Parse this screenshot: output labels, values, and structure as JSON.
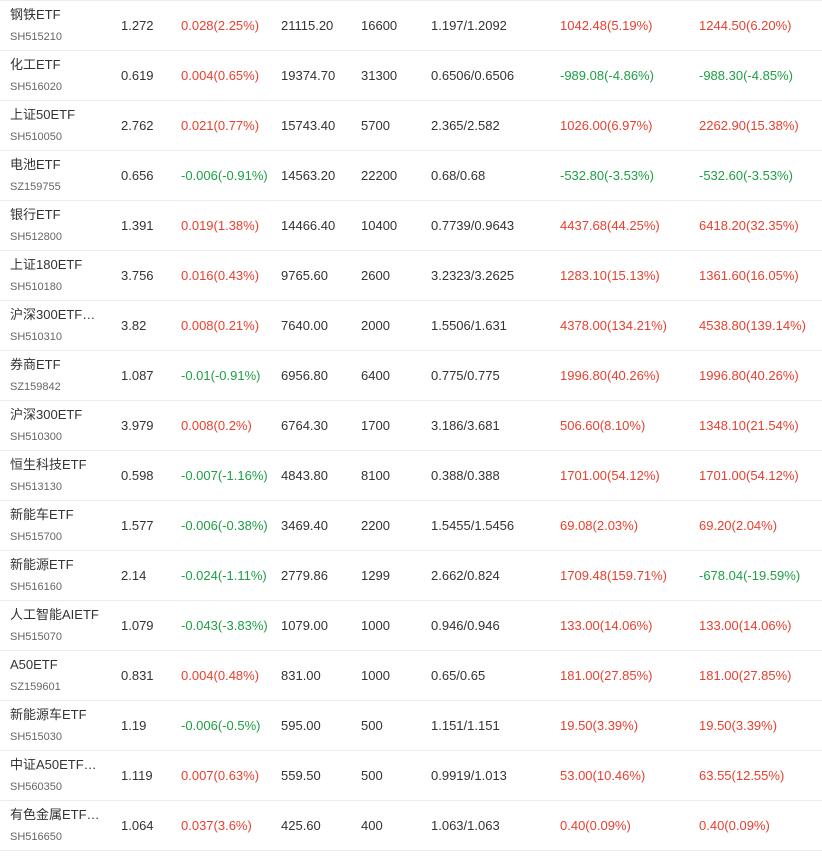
{
  "colors": {
    "up": "#e8402f",
    "down": "#1e9e45"
  },
  "rows": [
    {
      "name": "钢铁ETF",
      "code": "SH515210",
      "price": "1.272",
      "change": "0.028(2.25%)",
      "change_dir": "up",
      "amount": "21115.20",
      "shares": "16600",
      "cost": "1.197/1.2092",
      "pl1": "1042.48(5.19%)",
      "pl1_dir": "up",
      "pl2": "1244.50(6.20%)",
      "pl2_dir": "up"
    },
    {
      "name": "化工ETF",
      "code": "SH516020",
      "price": "0.619",
      "change": "0.004(0.65%)",
      "change_dir": "up",
      "amount": "19374.70",
      "shares": "31300",
      "cost": "0.6506/0.6506",
      "pl1": "-989.08(-4.86%)",
      "pl1_dir": "down",
      "pl2": "-988.30(-4.85%)",
      "pl2_dir": "down"
    },
    {
      "name": "上证50ETF",
      "code": "SH510050",
      "price": "2.762",
      "change": "0.021(0.77%)",
      "change_dir": "up",
      "amount": "15743.40",
      "shares": "5700",
      "cost": "2.365/2.582",
      "pl1": "1026.00(6.97%)",
      "pl1_dir": "up",
      "pl2": "2262.90(15.38%)",
      "pl2_dir": "up"
    },
    {
      "name": "电池ETF",
      "code": "SZ159755",
      "price": "0.656",
      "change": "-0.006(-0.91%)",
      "change_dir": "down",
      "amount": "14563.20",
      "shares": "22200",
      "cost": "0.68/0.68",
      "pl1": "-532.80(-3.53%)",
      "pl1_dir": "down",
      "pl2": "-532.60(-3.53%)",
      "pl2_dir": "down"
    },
    {
      "name": "银行ETF",
      "code": "SH512800",
      "price": "1.391",
      "change": "0.019(1.38%)",
      "change_dir": "up",
      "amount": "14466.40",
      "shares": "10400",
      "cost": "0.7739/0.9643",
      "pl1": "4437.68(44.25%)",
      "pl1_dir": "up",
      "pl2": "6418.20(32.35%)",
      "pl2_dir": "up"
    },
    {
      "name": "上证180ETF",
      "code": "SH510180",
      "price": "3.756",
      "change": "0.016(0.43%)",
      "change_dir": "up",
      "amount": "9765.60",
      "shares": "2600",
      "cost": "3.2323/3.2625",
      "pl1": "1283.10(15.13%)",
      "pl1_dir": "up",
      "pl2": "1361.60(16.05%)",
      "pl2_dir": "up"
    },
    {
      "name": "沪深300ETF…",
      "code": "SH510310",
      "price": "3.82",
      "change": "0.008(0.21%)",
      "change_dir": "up",
      "amount": "7640.00",
      "shares": "2000",
      "cost": "1.5506/1.631",
      "pl1": "4378.00(134.21%)",
      "pl1_dir": "up",
      "pl2": "4538.80(139.14%)",
      "pl2_dir": "up"
    },
    {
      "name": "券商ETF",
      "code": "SZ159842",
      "price": "1.087",
      "change": "-0.01(-0.91%)",
      "change_dir": "down",
      "amount": "6956.80",
      "shares": "6400",
      "cost": "0.775/0.775",
      "pl1": "1996.80(40.26%)",
      "pl1_dir": "up",
      "pl2": "1996.80(40.26%)",
      "pl2_dir": "up"
    },
    {
      "name": "沪深300ETF",
      "code": "SH510300",
      "price": "3.979",
      "change": "0.008(0.2%)",
      "change_dir": "up",
      "amount": "6764.30",
      "shares": "1700",
      "cost": "3.186/3.681",
      "pl1": "506.60(8.10%)",
      "pl1_dir": "up",
      "pl2": "1348.10(21.54%)",
      "pl2_dir": "up"
    },
    {
      "name": "恒生科技ETF",
      "code": "SH513130",
      "price": "0.598",
      "change": "-0.007(-1.16%)",
      "change_dir": "down",
      "amount": "4843.80",
      "shares": "8100",
      "cost": "0.388/0.388",
      "pl1": "1701.00(54.12%)",
      "pl1_dir": "up",
      "pl2": "1701.00(54.12%)",
      "pl2_dir": "up"
    },
    {
      "name": "新能车ETF",
      "code": "SH515700",
      "price": "1.577",
      "change": "-0.006(-0.38%)",
      "change_dir": "down",
      "amount": "3469.40",
      "shares": "2200",
      "cost": "1.5455/1.5456",
      "pl1": "69.08(2.03%)",
      "pl1_dir": "up",
      "pl2": "69.20(2.04%)",
      "pl2_dir": "up"
    },
    {
      "name": "新能源ETF",
      "code": "SH516160",
      "price": "2.14",
      "change": "-0.024(-1.11%)",
      "change_dir": "down",
      "amount": "2779.86",
      "shares": "1299",
      "cost": "2.662/0.824",
      "pl1": "1709.48(159.71%)",
      "pl1_dir": "up",
      "pl2": "-678.04(-19.59%)",
      "pl2_dir": "down"
    },
    {
      "name": "人工智能AIETF",
      "code": "SH515070",
      "price": "1.079",
      "change": "-0.043(-3.83%)",
      "change_dir": "down",
      "amount": "1079.00",
      "shares": "1000",
      "cost": "0.946/0.946",
      "pl1": "133.00(14.06%)",
      "pl1_dir": "up",
      "pl2": "133.00(14.06%)",
      "pl2_dir": "up"
    },
    {
      "name": "A50ETF",
      "code": "SZ159601",
      "price": "0.831",
      "change": "0.004(0.48%)",
      "change_dir": "up",
      "amount": "831.00",
      "shares": "1000",
      "cost": "0.65/0.65",
      "pl1": "181.00(27.85%)",
      "pl1_dir": "up",
      "pl2": "181.00(27.85%)",
      "pl2_dir": "up"
    },
    {
      "name": "新能源车ETF",
      "code": "SH515030",
      "price": "1.19",
      "change": "-0.006(-0.5%)",
      "change_dir": "down",
      "amount": "595.00",
      "shares": "500",
      "cost": "1.151/1.151",
      "pl1": "19.50(3.39%)",
      "pl1_dir": "up",
      "pl2": "19.50(3.39%)",
      "pl2_dir": "up"
    },
    {
      "name": "中证A50ETF…",
      "code": "SH560350",
      "price": "1.119",
      "change": "0.007(0.63%)",
      "change_dir": "up",
      "amount": "559.50",
      "shares": "500",
      "cost": "0.9919/1.013",
      "pl1": "53.00(10.46%)",
      "pl1_dir": "up",
      "pl2": "63.55(12.55%)",
      "pl2_dir": "up"
    },
    {
      "name": "有色金属ETF…",
      "code": "SH516650",
      "price": "1.064",
      "change": "0.037(3.6%)",
      "change_dir": "up",
      "amount": "425.60",
      "shares": "400",
      "cost": "1.063/1.063",
      "pl1": "0.40(0.09%)",
      "pl1_dir": "up",
      "pl2": "0.40(0.09%)",
      "pl2_dir": "up"
    }
  ]
}
